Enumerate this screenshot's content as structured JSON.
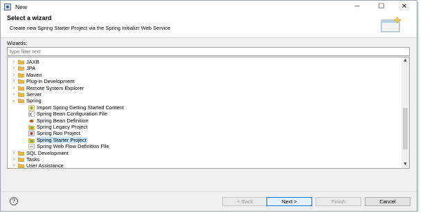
{
  "window": {
    "title": "New",
    "minimize": "─",
    "maximize": "☐",
    "close": "✕"
  },
  "header": {
    "title": "Select a wizard",
    "description": "Create new Spring Starter Project via the Spring Initializr Web Service"
  },
  "wizards_label": "Wizards:",
  "filter": {
    "value": "",
    "placeholder": "type filter text"
  },
  "tree": [
    {
      "label": "JAXB",
      "icon": "folder-icon",
      "twisty": "›",
      "level": 0
    },
    {
      "label": "JPA",
      "icon": "folder-icon",
      "twisty": "›",
      "level": 0
    },
    {
      "label": "Maven",
      "icon": "folder-icon",
      "twisty": "›",
      "level": 0
    },
    {
      "label": "Plug-in Development",
      "icon": "folder-icon",
      "twisty": "›",
      "level": 0
    },
    {
      "label": "Remote System Explorer",
      "icon": "folder-icon",
      "twisty": "›",
      "level": 0
    },
    {
      "label": "Server",
      "icon": "folder-icon",
      "twisty": "›",
      "level": 0
    },
    {
      "label": "Spring",
      "icon": "folder-icon",
      "twisty": "⌄",
      "level": 0
    },
    {
      "label": "Import Spring Getting Started Content",
      "icon": "spring-import-icon",
      "twisty": "",
      "level": 1
    },
    {
      "label": "Spring Bean Configuration File",
      "icon": "spring-bean-config-icon",
      "twisty": "",
      "level": 1
    },
    {
      "label": "Spring Bean Definition",
      "icon": "spring-bean-icon",
      "twisty": "",
      "level": 1
    },
    {
      "label": "Spring Legacy Project",
      "icon": "spring-project-icon",
      "twisty": "",
      "level": 1
    },
    {
      "label": "Spring Roo Project",
      "icon": "spring-roo-icon",
      "twisty": "",
      "level": 1
    },
    {
      "label": "Spring Starter Project",
      "icon": "spring-starter-icon",
      "twisty": "",
      "level": 1,
      "selected": true
    },
    {
      "label": "Spring Web Flow Definition File",
      "icon": "spring-webflow-icon",
      "twisty": "",
      "level": 1
    },
    {
      "label": "SQL Development",
      "icon": "folder-icon",
      "twisty": "›",
      "level": 0
    },
    {
      "label": "Tasks",
      "icon": "folder-icon",
      "twisty": "›",
      "level": 0
    },
    {
      "label": "User Assistance",
      "icon": "folder-icon",
      "twisty": "›",
      "level": 0
    }
  ],
  "buttons": {
    "help": "?",
    "back": "< Back",
    "next": "Next >",
    "finish": "Finish",
    "cancel": "Cancel"
  },
  "colors": {
    "selection": "#cce8ff",
    "folder": "#e8b64c",
    "accent": "#0078d7"
  }
}
